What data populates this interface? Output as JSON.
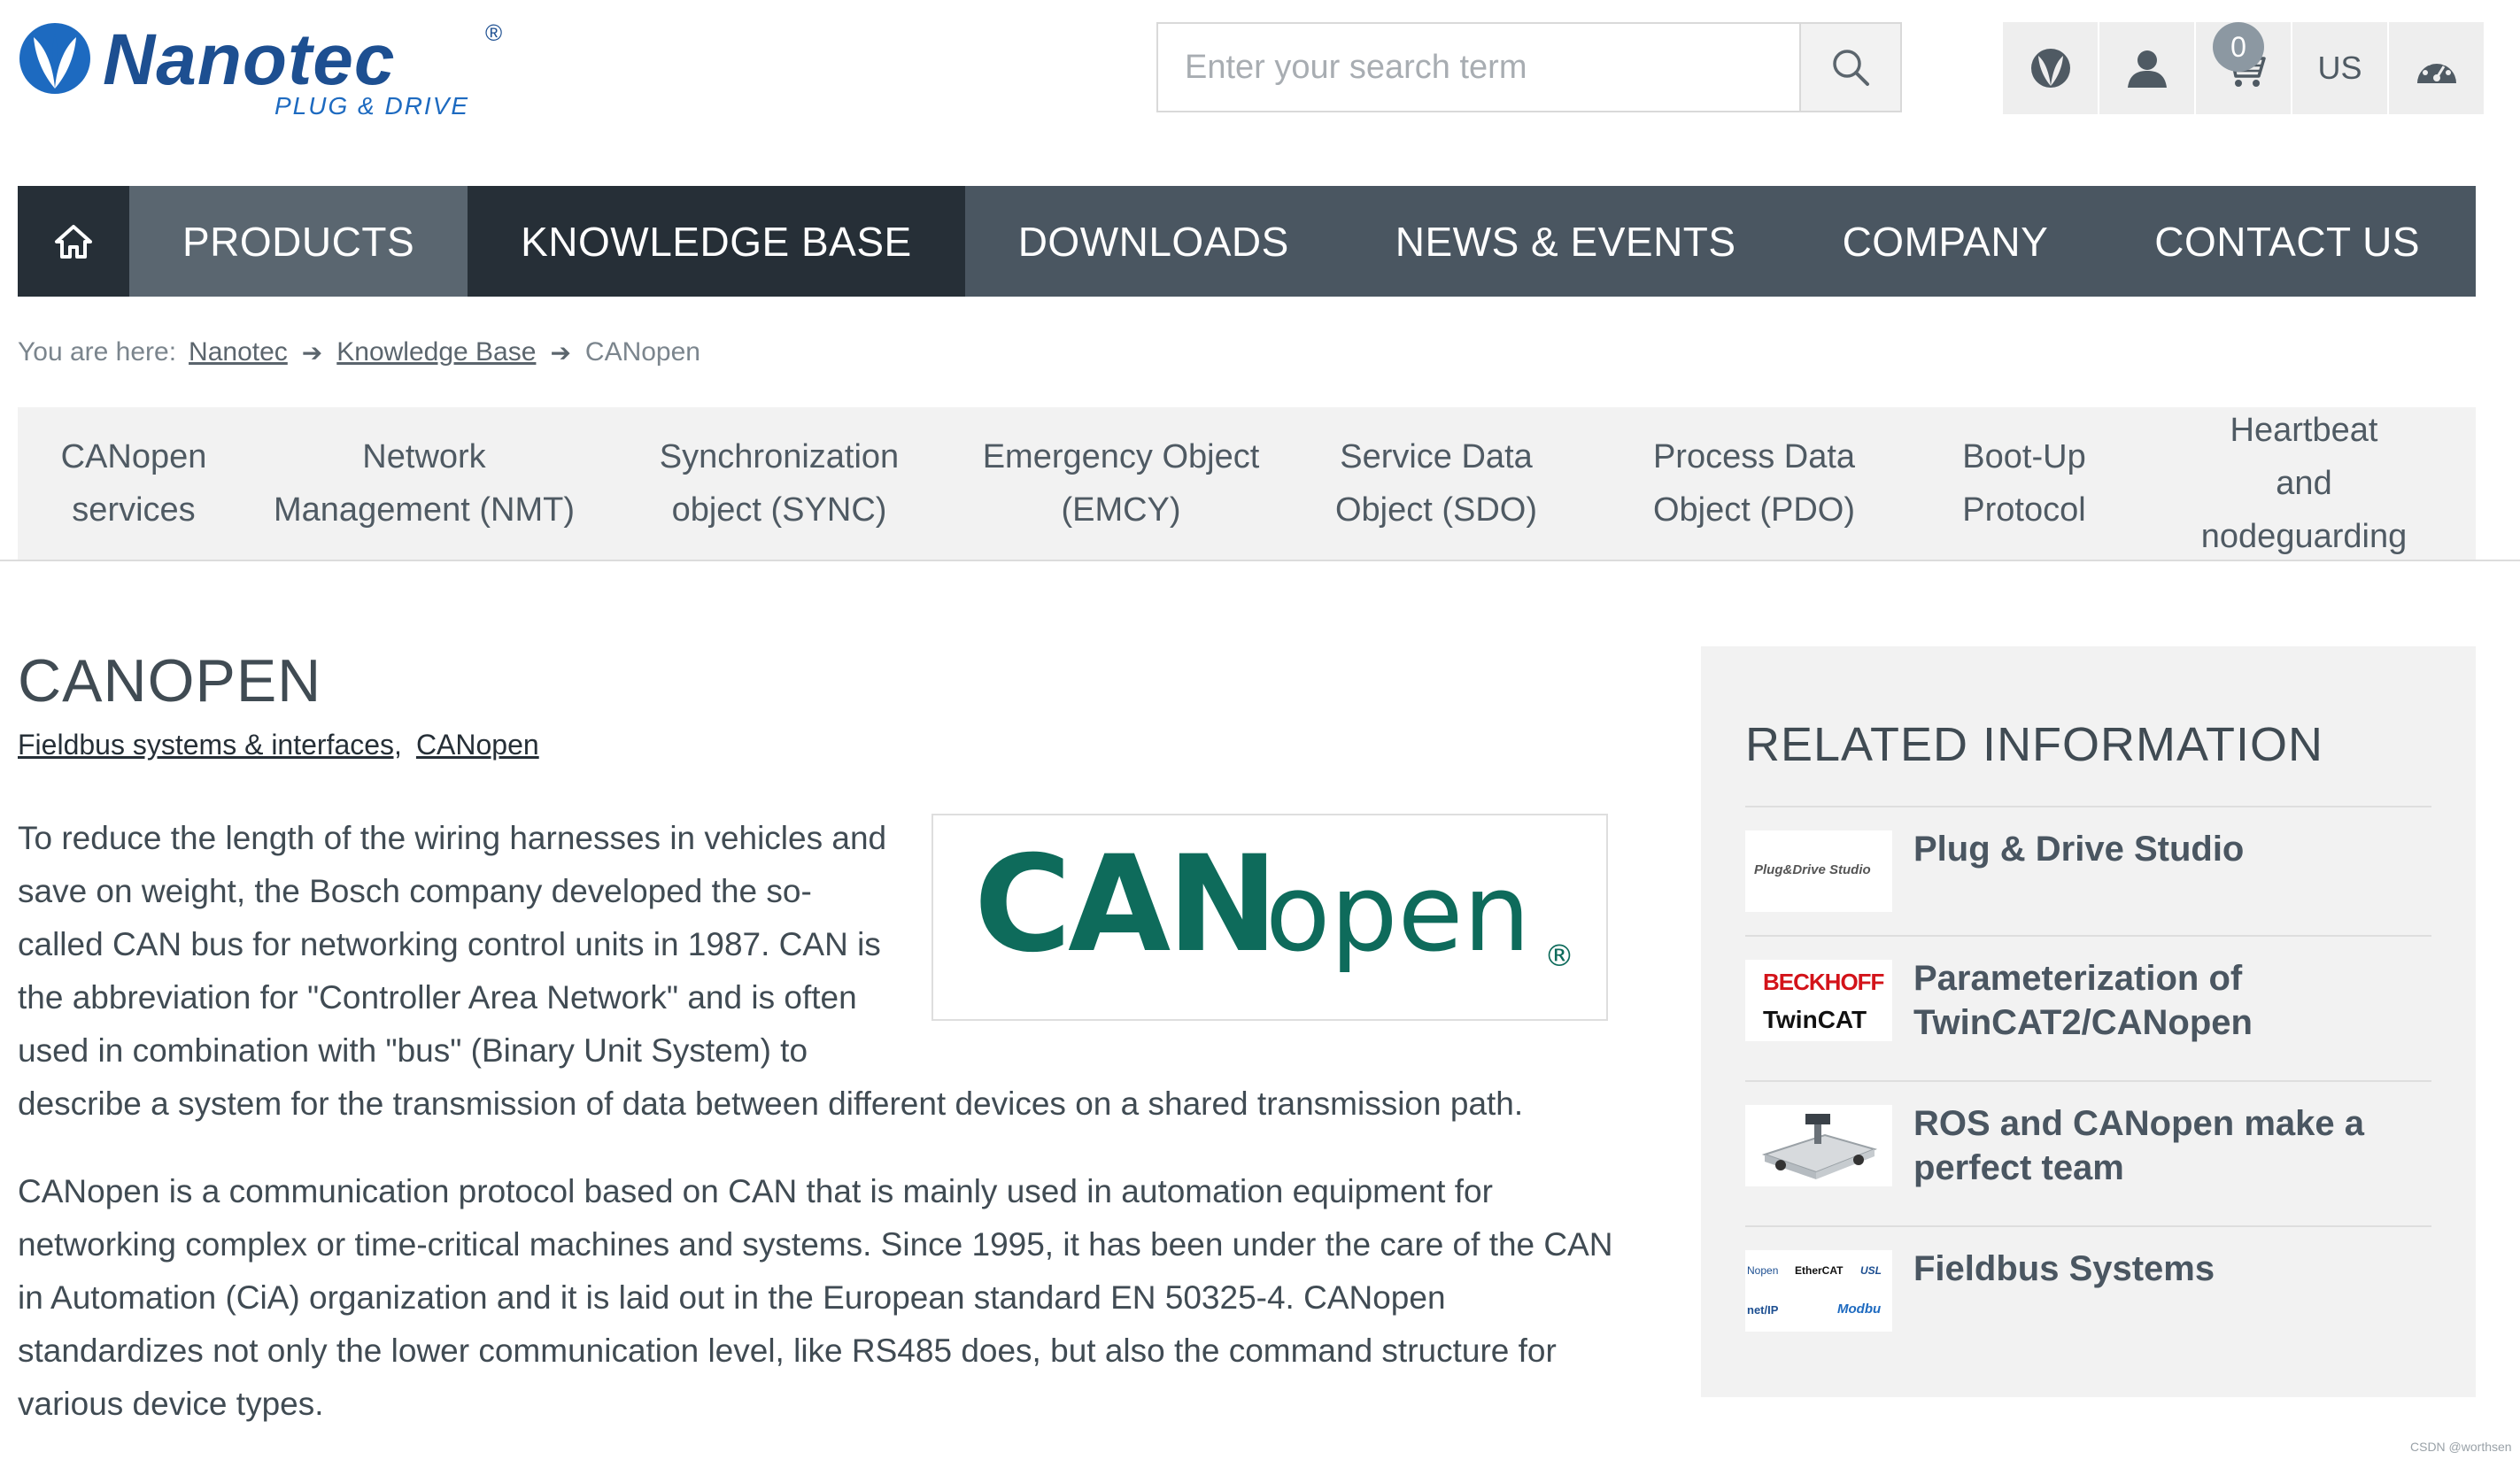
{
  "header": {
    "logo": {
      "name": "Nanotec",
      "registered": "®",
      "tagline": "PLUG & DRIVE"
    },
    "search": {
      "placeholder": "Enter your search term",
      "value": ""
    },
    "icons": [
      "nanotec-leaf-icon",
      "user-icon",
      "cart-icon",
      "region",
      "dashboard-icon"
    ],
    "cart_count": "0",
    "region": "US"
  },
  "nav": {
    "home_icon": "home-icon",
    "items": [
      "PRODUCTS",
      "KNOWLEDGE BASE",
      "DOWNLOADS",
      "NEWS & EVENTS",
      "COMPANY",
      "CONTACT US"
    ],
    "active": "KNOWLEDGE BASE"
  },
  "breadcrumb": {
    "prefix": "You are here:",
    "items": [
      "Nanotec",
      "Knowledge Base",
      "CANopen"
    ]
  },
  "subnav": {
    "items": [
      {
        "line1": "CANopen",
        "line2": "services"
      },
      {
        "line1": "Network",
        "line2": "Management (NMT)"
      },
      {
        "line1": "Synchronization",
        "line2": "object (SYNC)"
      },
      {
        "line1": "Emergency Object",
        "line2": "(EMCY)"
      },
      {
        "line1": "Service Data",
        "line2": "Object (SDO)"
      },
      {
        "line1": "Process Data",
        "line2": "Object (PDO)"
      },
      {
        "line1": "Boot-Up",
        "line2": "Protocol"
      },
      {
        "line1": "Heartbeat and",
        "line2": "nodeguarding"
      }
    ]
  },
  "main": {
    "title": "CANOPEN",
    "tags": [
      "Fieldbus systems & interfaces,",
      "CANopen"
    ],
    "image_logo": {
      "can": "CAN",
      "open": "open",
      "reg": "®"
    },
    "paragraphs": [
      "To reduce the length of the wiring harnesses in vehicles and save on weight, the Bosch company developed the so-called CAN bus for networking control units in 1987. CAN is the abbreviation for \"Controller Area Network\" and is often used in combination with \"bus\" (Binary Unit System) to describe a system for the transmission of data between different devices on a shared transmission path.",
      "CANopen is a communication protocol based on CAN that is mainly used in automation equipment for networking complex or time-critical machines and systems. Since 1995, it has been under the care of the CAN in Automation (CiA) organization and it is laid out in the European standard EN 50325-4. CANopen standardizes not only the lower communication level, like RS485 does, but also the command structure for various device types."
    ]
  },
  "related": {
    "title": "RELATED INFORMATION",
    "items": [
      {
        "label": "Plug & Drive Studio",
        "thumb_text": "Plug&Drive Studio"
      },
      {
        "label": "Parameterization of TwinCAT2/CANopen",
        "thumb_top": "BECKHOFF",
        "thumb_bottom": "TwinCAT"
      },
      {
        "label": "ROS and CANopen make a perfect team"
      },
      {
        "label": "Fieldbus Systems",
        "thumb_logos": [
          "Nopen",
          "EtherCAT",
          "USL",
          "net/IP",
          "Modbu"
        ]
      }
    ]
  },
  "watermark": "CSDN @worthsen",
  "colors": {
    "nav_bg": "#4a5661",
    "nav_active": "#262f37",
    "brand_blue": "#1d4f91",
    "canopen_green": "#0e6b5b"
  }
}
